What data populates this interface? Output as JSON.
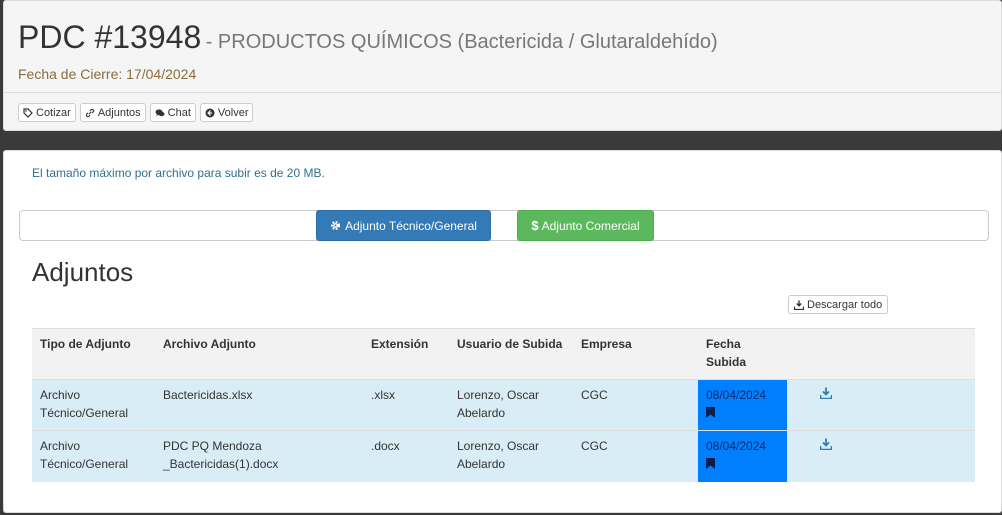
{
  "header": {
    "title": "PDC #13948",
    "subtitle": "- PRODUCTOS QUÍMICOS (Bactericida / Glutaraldehído)",
    "fecha_cierre": "Fecha de Cierre: 17/04/2024"
  },
  "toolbar": [
    {
      "label": "Cotizar",
      "icon": "tag-icon"
    },
    {
      "label": "Adjuntos",
      "icon": "link-icon"
    },
    {
      "label": "Chat",
      "icon": "comments-icon"
    },
    {
      "label": "Volver",
      "icon": "arrow-circle-left-icon"
    }
  ],
  "upload": {
    "info": "El tamaño máximo por archivo para subir es de 20 MB.",
    "tecnico_label": "Adjunto Técnico/General",
    "comercial_label": "Adjunto Comercial"
  },
  "adjuntos": {
    "heading": "Adjuntos",
    "descargar_todo": "Descargar todo",
    "columns": [
      "Tipo de Adjunto",
      "Archivo Adjunto",
      "Extensión",
      "Usuario de Subida",
      "Empresa",
      "Fecha Subida",
      ""
    ],
    "rows": [
      {
        "tipo": "Archivo Técnico/General",
        "archivo": "Bactericidas.xlsx",
        "extension": ".xlsx",
        "usuario": "Lorenzo, Oscar Abelardo",
        "empresa": "CGC",
        "fecha": "08/04/2024"
      },
      {
        "tipo": "Archivo Técnico/General",
        "archivo": "PDC PQ Mendoza _Bactericidas(1).docx",
        "extension": ".docx",
        "usuario": "Lorenzo, Oscar Abelardo",
        "empresa": "CGC",
        "fecha": "08/04/2024"
      }
    ]
  },
  "colors": {
    "primary": "#337ab7",
    "success": "#5cb85c",
    "date_highlight": "#0080ff",
    "row_info": "#d9edf7"
  }
}
